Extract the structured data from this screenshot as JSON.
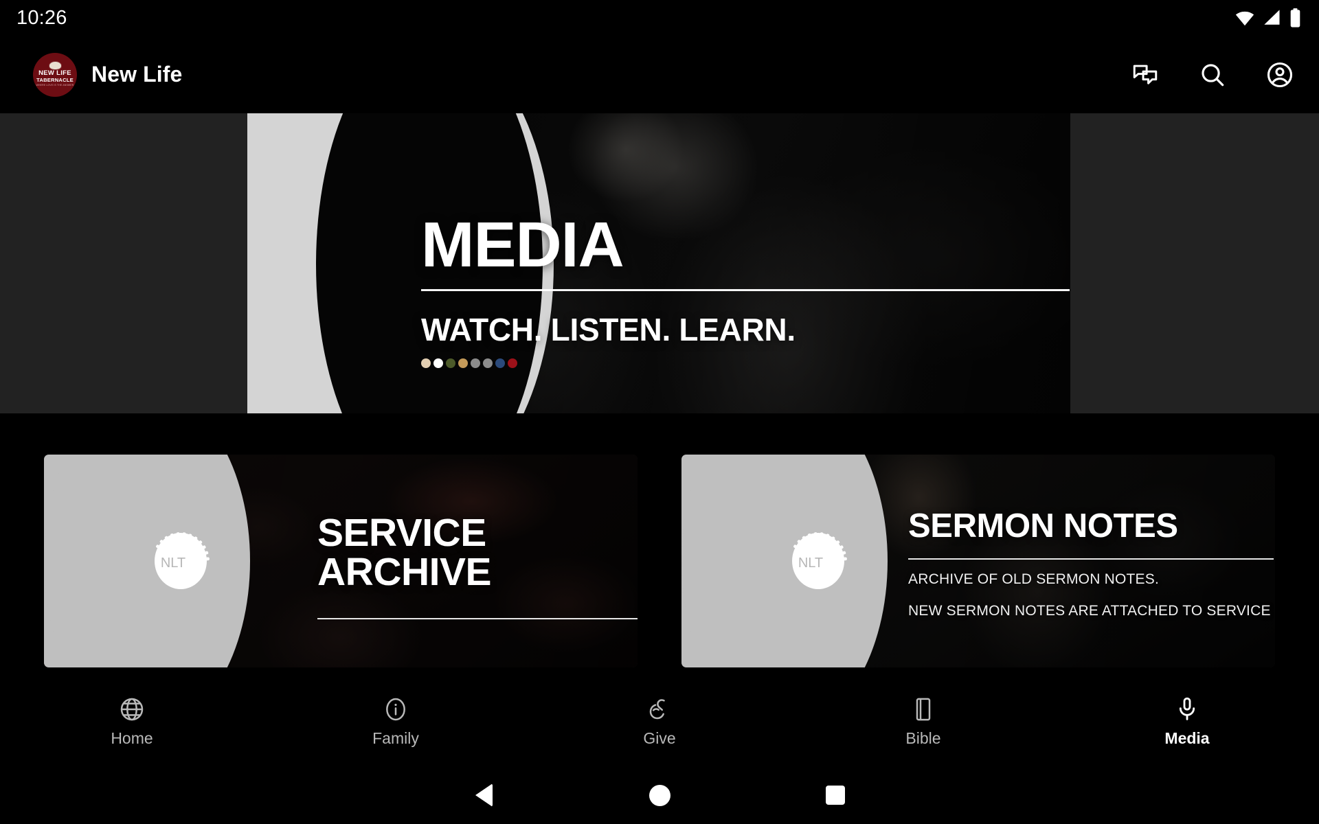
{
  "status_bar": {
    "clock": "10:26",
    "icons": [
      "wifi-icon",
      "cellular-signal-icon",
      "battery-icon"
    ]
  },
  "app_bar": {
    "logo": {
      "name": "new-life-tabernacle-logo",
      "line1": "NEW LIFE",
      "line2": "TABERNACLE",
      "line3": "WHERE LOVE IS THE ANSWER",
      "color": "#6d0d13"
    },
    "title": "New Life",
    "actions": [
      {
        "name": "messages-icon",
        "label": "Messages"
      },
      {
        "name": "search-icon",
        "label": "Search"
      },
      {
        "name": "account-icon",
        "label": "Account"
      }
    ]
  },
  "hero": {
    "name": "media-hero-banner",
    "title": "MEDIA",
    "subtitle": "WATCH. LISTEN. LEARN.",
    "dots": [
      "#e3cfb2",
      "#ffffff",
      "#4c5a29",
      "#c49a59",
      "#8c8c8c",
      "#8c8c8c",
      "#2b4a7b",
      "#9c1119"
    ]
  },
  "cards": [
    {
      "name": "service-archive-card",
      "seal_text": "NLT",
      "title_line1": "SERVICE",
      "title_line2": "ARCHIVE",
      "subtitle_line1": "",
      "subtitle_line2": ""
    },
    {
      "name": "sermon-notes-card",
      "seal_text": "NLT",
      "title_line1": "SERMON NOTES",
      "title_line2": "",
      "subtitle_line1": "ARCHIVE OF OLD SERMON NOTES.",
      "subtitle_line2": "NEW SERMON NOTES ARE ATTACHED TO SERVICE"
    }
  ],
  "bottom_nav": {
    "active": "Media",
    "items": [
      {
        "label": "Home",
        "icon": "globe-icon"
      },
      {
        "label": "Family",
        "icon": "info-circle-icon"
      },
      {
        "label": "Give",
        "icon": "giving-hand-icon"
      },
      {
        "label": "Bible",
        "icon": "book-icon"
      },
      {
        "label": "Media",
        "icon": "microphone-icon"
      }
    ]
  },
  "system_nav": {
    "back": "back-button",
    "home": "home-button",
    "recents": "recents-button"
  }
}
